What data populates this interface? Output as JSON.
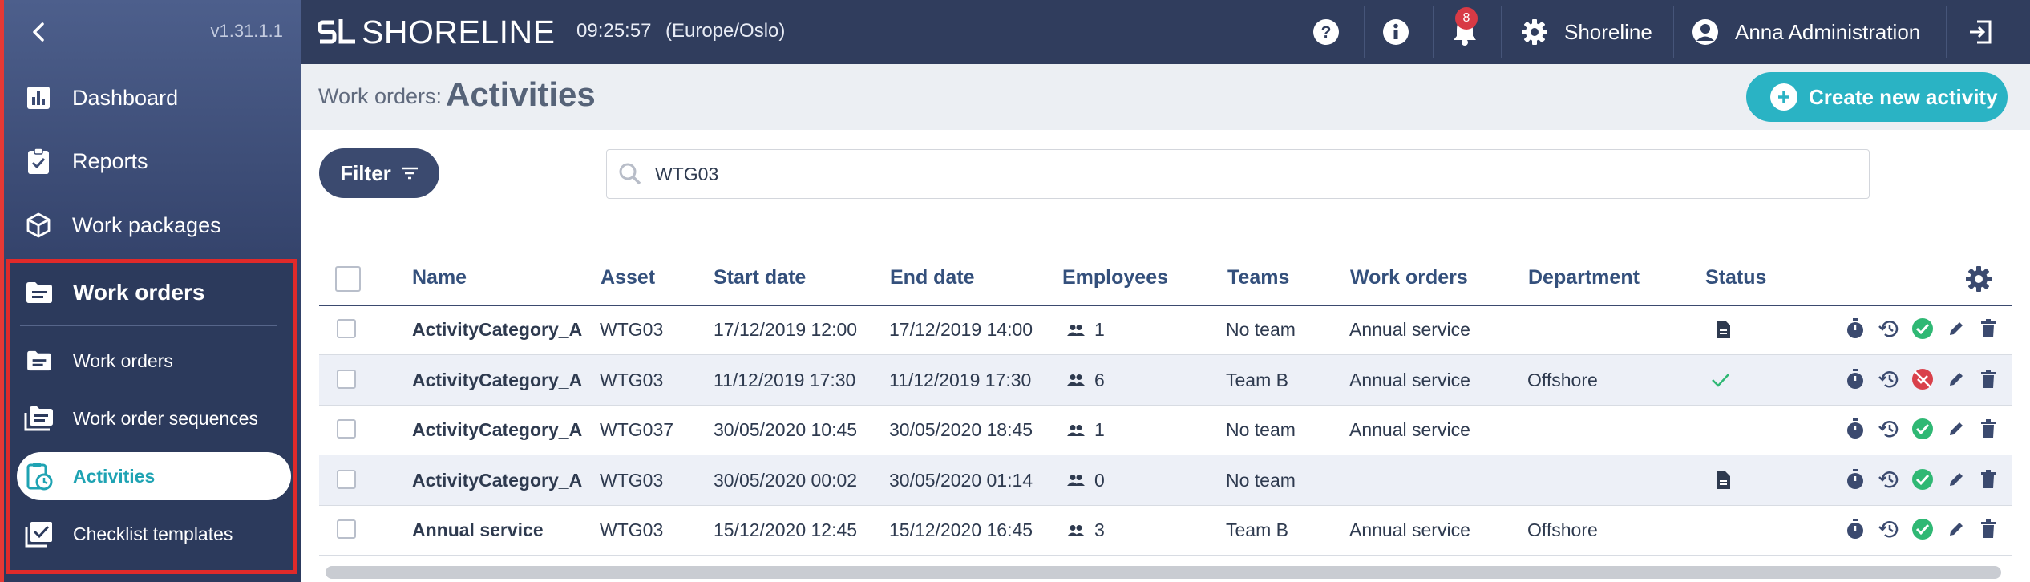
{
  "app": {
    "version": "v1.31.1.1",
    "brand": "SHORELINE",
    "clock": "09:25:57",
    "timezone": "(Europe/Oslo)"
  },
  "sidebar": {
    "items": [
      {
        "label": "Dashboard",
        "icon": "chart-icon"
      },
      {
        "label": "Reports",
        "icon": "clipboard-check-icon"
      },
      {
        "label": "Work packages",
        "icon": "package-icon"
      }
    ],
    "group": {
      "label": "Work orders",
      "sub": [
        {
          "label": "Work orders"
        },
        {
          "label": "Work order sequences"
        },
        {
          "label": "Activities"
        },
        {
          "label": "Checklist templates"
        }
      ]
    }
  },
  "topbar": {
    "notifications": "8",
    "org_name": "Shoreline",
    "user_name": "Anna Administration"
  },
  "page": {
    "breadcrumb": "Work orders:",
    "title": "Activities",
    "create_label": "Create new activity"
  },
  "filter": {
    "label": "Filter"
  },
  "search": {
    "value": "WTG03"
  },
  "table": {
    "headers": [
      "Name",
      "Asset",
      "Start date",
      "End date",
      "Employees",
      "Teams",
      "Work orders",
      "Department",
      "Status"
    ],
    "rows": [
      {
        "name": "ActivityCategory_A",
        "asset": "WTG03",
        "start": "17/12/2019 12:00",
        "end": "17/12/2019 14:00",
        "employees": "1",
        "team": "No team",
        "work_order": "Annual service",
        "department": "",
        "status": "document",
        "approval": "approved"
      },
      {
        "name": "ActivityCategory_A",
        "asset": "WTG03",
        "start": "11/12/2019 17:30",
        "end": "11/12/2019 17:30",
        "employees": "6",
        "team": "Team B",
        "work_order": "Annual service",
        "department": "Offshore",
        "status": "check",
        "approval": "rejected"
      },
      {
        "name": "ActivityCategory_A",
        "asset": "WTG037",
        "start": "30/05/2020 10:45",
        "end": "30/05/2020 18:45",
        "employees": "1",
        "team": "No team",
        "work_order": "Annual service",
        "department": "",
        "status": "none",
        "approval": "approved"
      },
      {
        "name": "ActivityCategory_A",
        "asset": "WTG03",
        "start": "30/05/2020 00:02",
        "end": "30/05/2020 01:14",
        "employees": "0",
        "team": "No team",
        "work_order": "",
        "department": "",
        "status": "document",
        "approval": "approved"
      },
      {
        "name": "Annual service",
        "asset": "WTG03",
        "start": "15/12/2020 12:45",
        "end": "15/12/2020 16:45",
        "employees": "3",
        "team": "Team B",
        "work_order": "Annual service",
        "department": "Offshore",
        "status": "none",
        "approval": "approved"
      }
    ]
  },
  "colors": {
    "accent": "#2ab3c4",
    "sidebar": "#34436b",
    "topbar": "#303d5d",
    "approved": "#2fb874",
    "rejected": "#d9404a"
  }
}
